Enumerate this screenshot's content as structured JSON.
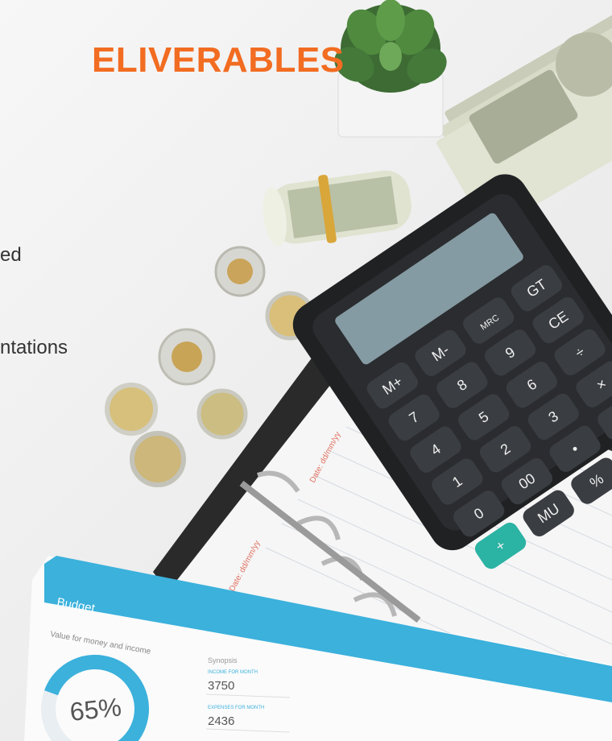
{
  "slide": {
    "title": "ELIVERABLES",
    "bullets": [
      "ed",
      "ntations"
    ]
  },
  "photo": {
    "calculator_keys": [
      "M+",
      "M-",
      "MRC",
      "GT",
      "7",
      "8",
      "9",
      "CE",
      "4",
      "5",
      "6",
      "÷",
      "1",
      "2",
      "3",
      "×",
      "0",
      "00",
      "•",
      "−",
      "+",
      "MU",
      "%",
      "▸",
      "="
    ],
    "budget_sheet": {
      "heading": "Budget",
      "subheading": "Value for money and income",
      "synopsis": "Synopsis",
      "income_label": "INCOME FOR MONTH",
      "income_value": "3750",
      "expense_label": "EXPENSES FOR MONTH",
      "expense_value": "2436",
      "donut_percent": "65%"
    },
    "notebook_dates": [
      "Date: dd/mm/yy",
      "Date: dd/mm/yy"
    ]
  },
  "colors": {
    "accent": "#f26c21",
    "teal": "#2bb3a3",
    "budget_blue": "#3bb1dc"
  }
}
